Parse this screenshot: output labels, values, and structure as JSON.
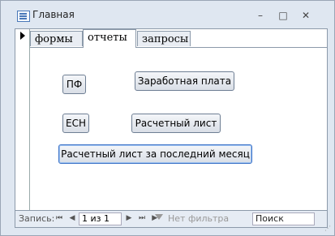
{
  "window": {
    "title": "Главная"
  },
  "titlebar": {
    "minimize": "–",
    "maximize": "□",
    "close": "✕"
  },
  "tabs": [
    {
      "label": "формы"
    },
    {
      "label": "отчеты"
    },
    {
      "label": "запросы"
    }
  ],
  "buttons": {
    "pf": "ПФ",
    "salary": "Заработная плата",
    "esn": "ЕСН",
    "payslip": "Расчетный лист",
    "payslip_last_month": "Расчетный лист за последний месяц"
  },
  "navigation": {
    "record_label": "Запись:",
    "first": "⏮",
    "prev": "◀",
    "count": "1 из 1",
    "next": "▶",
    "last": "⏭",
    "new": "▶*",
    "filter": "Нет фильтра",
    "search_placeholder": "Поиск"
  }
}
